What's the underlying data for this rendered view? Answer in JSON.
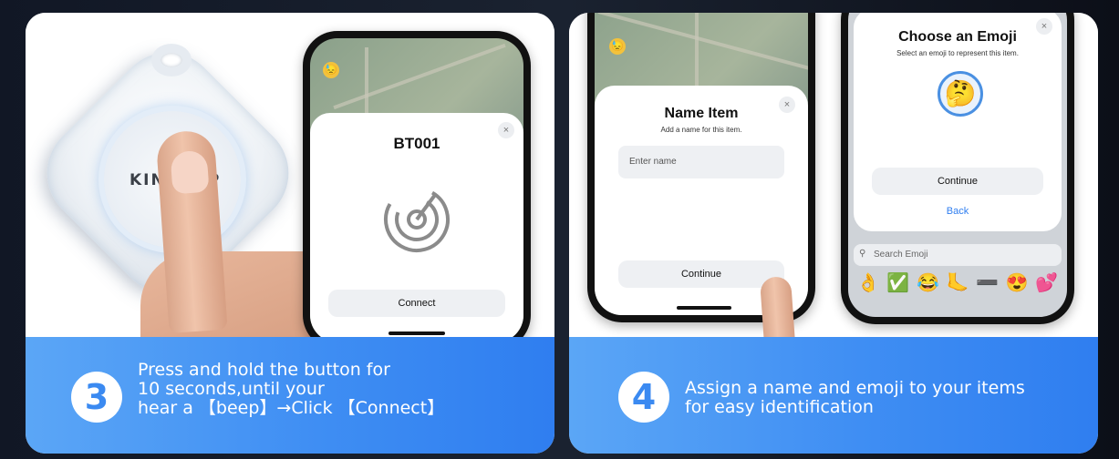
{
  "step3": {
    "number": "3",
    "lines": [
      "Press and hold the button for",
      "10 seconds,until your",
      "hear a 【beep】→Click 【Connect】"
    ],
    "tracker_brand": "KINDOEP",
    "phone": {
      "title": "BT001",
      "close": "×",
      "connect_label": "Connect"
    }
  },
  "step4": {
    "number": "4",
    "lines": [
      "Assign a name and emoji to  your items",
      "for easy identification"
    ],
    "name_phone": {
      "title": "Name Item",
      "subtitle": "Add a name for this item.",
      "close": "×",
      "input_placeholder": "Enter name",
      "continue_label": "Continue"
    },
    "emoji_phone": {
      "title": "Choose an Emoji",
      "subtitle": "Select an emoji to represent this item.",
      "close": "×",
      "selected_emoji": "🤔",
      "continue_label": "Continue",
      "back_label": "Back",
      "search_placeholder": "Search Emoji",
      "emoji_row": [
        "👌",
        "✅",
        "😂",
        "🦶",
        "➖",
        "😍",
        "💕"
      ]
    }
  },
  "colors": {
    "caption_blue": "#3f8ef3",
    "number_blue": "#3b8af1",
    "back_link": "#2f7ef0"
  }
}
